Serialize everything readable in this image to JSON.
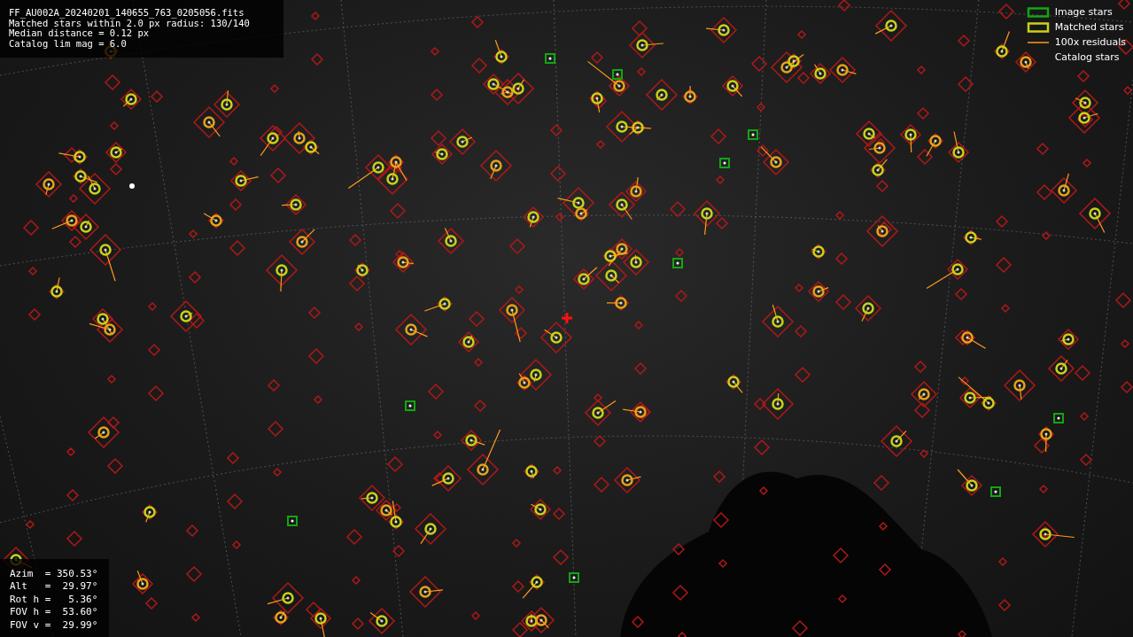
{
  "info_lines": [
    "FF_AU002A_20240201_140655_763_0205056.fits",
    "Matched stars within 2.0 px radius: 130/140",
    "Median distance = 0.12 px",
    "Catalog lim mag = 6.0"
  ],
  "legend": [
    {
      "kind": "image",
      "label": "Image stars"
    },
    {
      "kind": "matched",
      "label": "Matched stars"
    },
    {
      "kind": "residual",
      "label": "100x residuals"
    },
    {
      "kind": "catalog",
      "label": "Catalog stars"
    }
  ],
  "pointing_lines": [
    "Azim  = 350.53°",
    "Alt   =  29.97°",
    "Rot h =   5.36°",
    "FOV h =  53.60°",
    "FOV v =  29.99°"
  ]
}
